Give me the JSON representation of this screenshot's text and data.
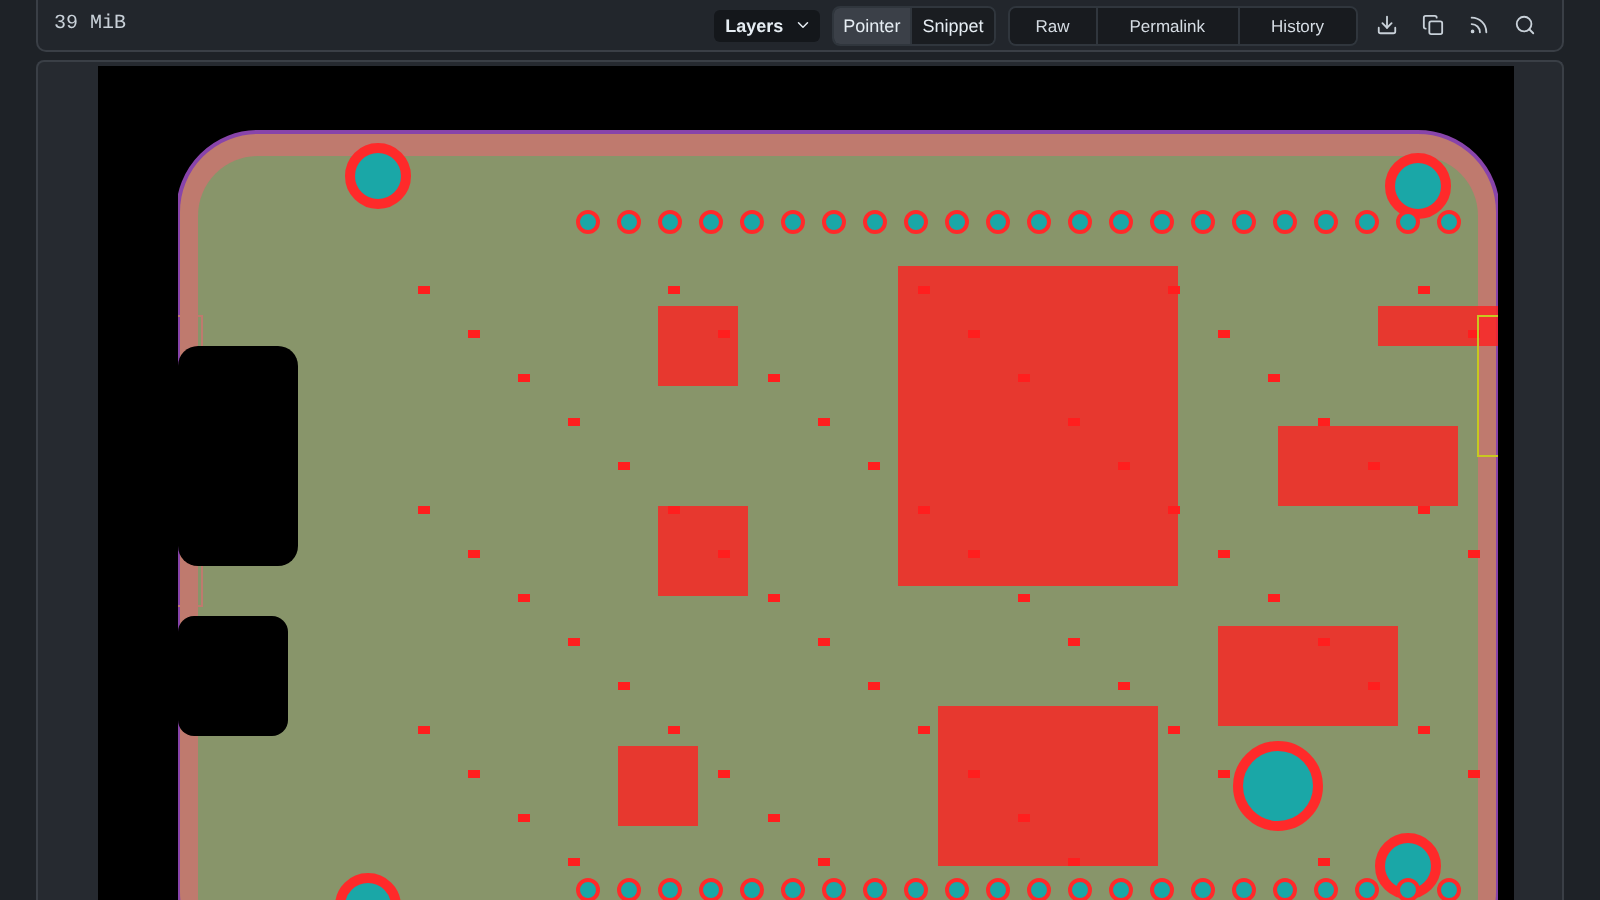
{
  "file_info": {
    "size": "39 MiB"
  },
  "layers_select": {
    "label": "Layers"
  },
  "modes": [
    {
      "label": "Pointer",
      "selected": true
    },
    {
      "label": "Snippet",
      "selected": false
    }
  ],
  "actions": [
    "Raw",
    "Permalink",
    "History"
  ]
}
